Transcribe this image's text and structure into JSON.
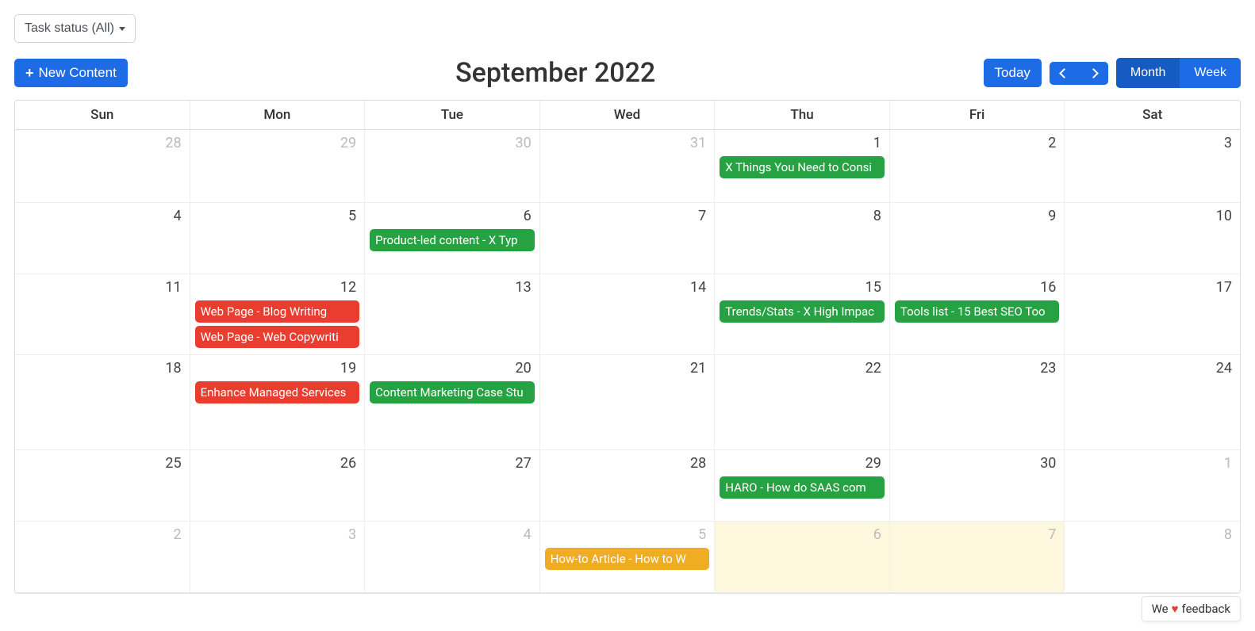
{
  "filter": {
    "label": "Task status (All)"
  },
  "toolbar": {
    "new_content": "New Content",
    "title": "September 2022",
    "today": "Today",
    "month": "Month",
    "week": "Week",
    "active_view": "month"
  },
  "day_headers": [
    "Sun",
    "Mon",
    "Tue",
    "Wed",
    "Thu",
    "Fri",
    "Sat"
  ],
  "weeks": [
    [
      {
        "num": 28,
        "other": true,
        "events": []
      },
      {
        "num": 29,
        "other": true,
        "events": []
      },
      {
        "num": 30,
        "other": true,
        "events": []
      },
      {
        "num": 31,
        "other": true,
        "events": []
      },
      {
        "num": 1,
        "other": false,
        "events": [
          {
            "text": "X Things You Need to Consi",
            "color": "green"
          }
        ]
      },
      {
        "num": 2,
        "other": false,
        "events": []
      },
      {
        "num": 3,
        "other": false,
        "events": []
      }
    ],
    [
      {
        "num": 4,
        "other": false,
        "events": []
      },
      {
        "num": 5,
        "other": false,
        "events": []
      },
      {
        "num": 6,
        "other": false,
        "events": [
          {
            "text": "Product-led content - X Typ",
            "color": "green"
          }
        ]
      },
      {
        "num": 7,
        "other": false,
        "events": []
      },
      {
        "num": 8,
        "other": false,
        "events": []
      },
      {
        "num": 9,
        "other": false,
        "events": []
      },
      {
        "num": 10,
        "other": false,
        "events": []
      }
    ],
    [
      {
        "num": 11,
        "other": false,
        "events": []
      },
      {
        "num": 12,
        "other": false,
        "events": [
          {
            "text": "Web Page - Blog Writing",
            "color": "red"
          },
          {
            "text": "Web Page - Web Copywriti",
            "color": "red"
          }
        ]
      },
      {
        "num": 13,
        "other": false,
        "events": []
      },
      {
        "num": 14,
        "other": false,
        "events": []
      },
      {
        "num": 15,
        "other": false,
        "events": [
          {
            "text": "Trends/Stats - X High Impac",
            "color": "green"
          }
        ]
      },
      {
        "num": 16,
        "other": false,
        "events": [
          {
            "text": "Tools list - 15 Best SEO Too",
            "color": "green"
          }
        ]
      },
      {
        "num": 17,
        "other": false,
        "events": []
      }
    ],
    [
      {
        "num": 18,
        "other": false,
        "events": []
      },
      {
        "num": 19,
        "other": false,
        "events": [
          {
            "text": "Enhance Managed Services",
            "color": "red"
          }
        ]
      },
      {
        "num": 20,
        "other": false,
        "events": [
          {
            "text": "Content Marketing Case Stu",
            "color": "green"
          }
        ]
      },
      {
        "num": 21,
        "other": false,
        "events": []
      },
      {
        "num": 22,
        "other": false,
        "events": []
      },
      {
        "num": 23,
        "other": false,
        "events": []
      },
      {
        "num": 24,
        "other": false,
        "events": []
      }
    ],
    [
      {
        "num": 25,
        "other": false,
        "events": []
      },
      {
        "num": 26,
        "other": false,
        "events": []
      },
      {
        "num": 27,
        "other": false,
        "events": []
      },
      {
        "num": 28,
        "other": false,
        "events": []
      },
      {
        "num": 29,
        "other": false,
        "events": [
          {
            "text": "HARO - How do SAAS com",
            "color": "green"
          }
        ]
      },
      {
        "num": 30,
        "other": false,
        "events": []
      },
      {
        "num": 1,
        "other": true,
        "events": []
      }
    ],
    [
      {
        "num": 2,
        "other": true,
        "events": []
      },
      {
        "num": 3,
        "other": true,
        "events": []
      },
      {
        "num": 4,
        "other": true,
        "events": []
      },
      {
        "num": 5,
        "other": true,
        "events": [
          {
            "text": "How-to Article - How to W",
            "color": "orange"
          }
        ]
      },
      {
        "num": 6,
        "other": true,
        "highlight": true,
        "events": []
      },
      {
        "num": 7,
        "other": true,
        "highlight": true,
        "events": []
      },
      {
        "num": 8,
        "other": true,
        "events": []
      }
    ]
  ],
  "feedback": {
    "prefix": "We",
    "suffix": "feedback"
  }
}
